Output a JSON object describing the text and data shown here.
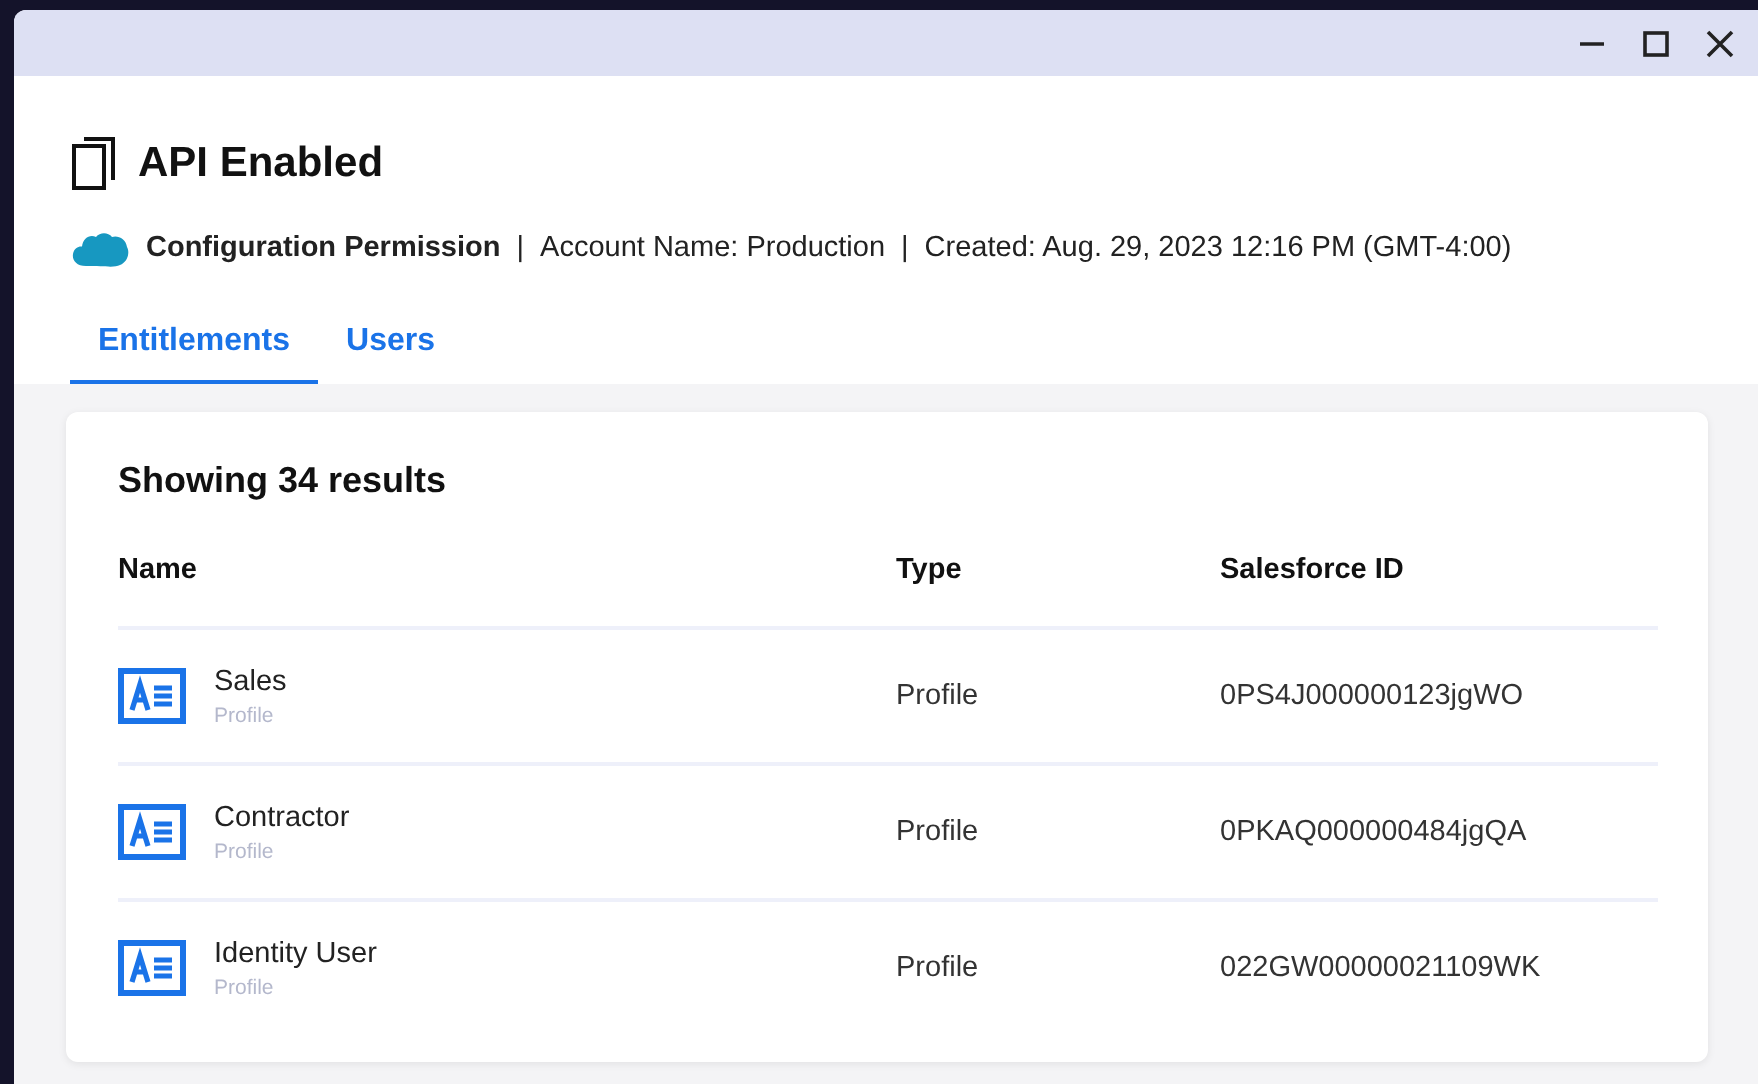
{
  "title": "API Enabled",
  "meta": {
    "category": "Configuration Permission",
    "parts": [
      "Account Name: Production",
      "Created: Aug. 29, 2023 12:16 PM (GMT-4:00)"
    ],
    "separator": "|"
  },
  "tabs": [
    {
      "label": "Entitlements",
      "selected": true
    },
    {
      "label": "Users",
      "selected": false
    }
  ],
  "results": {
    "heading": "Showing 34 results",
    "columns": [
      "Name",
      "Type",
      "Salesforce ID"
    ],
    "rows": [
      {
        "name": "Sales",
        "subtitle": "Profile",
        "type": "Profile",
        "id": "0PS4J000000123jgWO"
      },
      {
        "name": "Contractor",
        "subtitle": "Profile",
        "type": "Profile",
        "id": "0PKAQ000000484jgQA"
      },
      {
        "name": "Identity User",
        "subtitle": "Profile",
        "type": "Profile",
        "id": "022GW00000021109WK"
      }
    ]
  }
}
